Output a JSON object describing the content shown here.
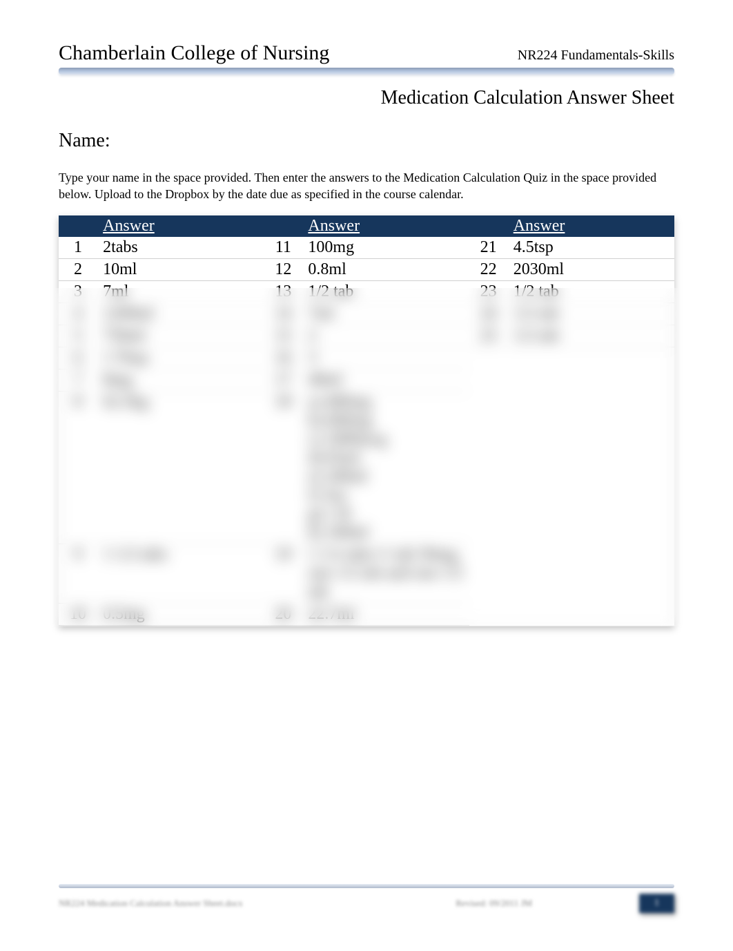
{
  "header": {
    "college": "Chamberlain College of Nursing",
    "course": "NR224 Fundamentals-Skills"
  },
  "title": "Medication Calculation Answer Sheet",
  "name_label": "Name:",
  "instructions": "Type your name in the space provided. Then enter the answers to the Medication Calculation Quiz in the space provided below.   Upload to the Dropbox by the date due as specified in the course calendar.",
  "table_headers": {
    "answer": "Answer"
  },
  "answers": {
    "col1": [
      {
        "n": "1",
        "v": "2tabs"
      },
      {
        "n": "2",
        "v": "10ml"
      },
      {
        "n": "3",
        "v": "7ml"
      },
      {
        "n": "4",
        "v": "1200ml"
      },
      {
        "n": "5",
        "v": "750ml"
      },
      {
        "n": "6",
        "v": "1 Tbsp"
      },
      {
        "n": "7",
        "v": "8mg"
      },
      {
        "n": "8",
        "v": "62.5kg"
      },
      {
        "n": "9",
        "v": "1 1/2 tabs"
      },
      {
        "n": "10",
        "v": "0.5mg"
      }
    ],
    "col2": [
      {
        "n": "11",
        "v": "100mg"
      },
      {
        "n": "12",
        "v": "0.8ml"
      },
      {
        "n": "13",
        "v": "1/2 tab"
      },
      {
        "n": "14",
        "v": "7ml"
      },
      {
        "n": "15",
        "v": "2"
      },
      {
        "n": "16",
        "v": "3"
      },
      {
        "n": "17",
        "v": "40ml"
      },
      {
        "n": "18",
        "v": "a) 400mg\nb) 600mg\nc) 1000mcg\nd) 65ml\ne) 240ml\nf) 3oz\ng) 1 lb\nh) 100ml"
      },
      {
        "n": "19",
        "v": "1 1/2 tabs=1 tab 50mg, one 1/2 tab and one 1/2 tab"
      },
      {
        "n": "20",
        "v": "22.7ml"
      }
    ],
    "col3": [
      {
        "n": "21",
        "v": "4.5tsp"
      },
      {
        "n": "22",
        "v": "2030ml"
      },
      {
        "n": "23",
        "v": "1/2 tab"
      },
      {
        "n": "24",
        "v": "1/2 tab"
      },
      {
        "n": "25",
        "v": "1/2 tab"
      }
    ]
  },
  "footer": {
    "left": "NR224 Medication Calculation Answer Sheet.docx",
    "center": "Revised: 09/2011 JM",
    "page": "1"
  }
}
